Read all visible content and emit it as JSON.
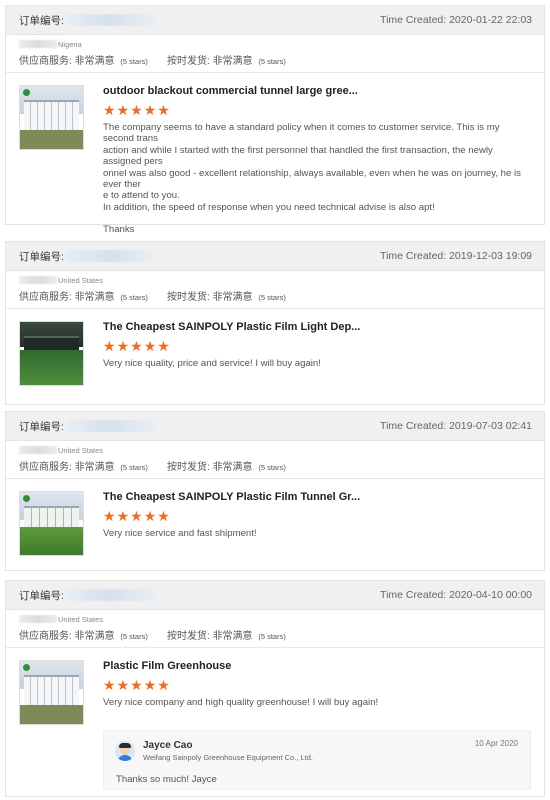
{
  "reviews": [
    {
      "order_label": "订单编号:",
      "time": "Time Created: 2020-01-22 22:03",
      "country": "Nigeria",
      "supplier_label": "供应商服务:",
      "supplier_value": "非常满意",
      "supplier_stars": "(5 stars)",
      "ship_label": "按时发货:",
      "ship_value": "非常满意",
      "ship_stars": "(5 stars)",
      "thumb_icon": "greenhouse-product-thumbnail",
      "title": "outdoor blackout commercial tunnel large gree...",
      "rating": 5,
      "text_lines": [
        "The company seems to have a standard policy when it comes to customer service. This is my second trans",
        "action and while I started with the first personnel that handled the first transaction, the newly assigned pers",
        "onnel was also good - excellent relationship, always available, even when he was on journey, he is ever ther",
        "e to attend to you.",
        "In addition, the speed of response when you need technical advise is also apt!"
      ],
      "closing": "Thanks"
    },
    {
      "order_label": "订单编号:",
      "time": "Time Created: 2019-12-03 19:09",
      "country": "United States",
      "supplier_label": "供应商服务:",
      "supplier_value": "非常满意",
      "supplier_stars": "(5 stars)",
      "ship_label": "按时发货:",
      "ship_value": "非常满意",
      "ship_stars": "(5 stars)",
      "thumb_icon": "light-dep-greenhouse-thumbnail",
      "title": "The Cheapest SAINPOLY Plastic Film Light Dep...",
      "rating": 5,
      "text": "Very nice quality, price and service! I will buy again!"
    },
    {
      "order_label": "订单编号:",
      "time": "Time Created: 2019-07-03 02:41",
      "country": "United States",
      "supplier_label": "供应商服务:",
      "supplier_value": "非常满意",
      "supplier_stars": "(5 stars)",
      "ship_label": "按时发货:",
      "ship_value": "非常满意",
      "ship_stars": "(5 stars)",
      "thumb_icon": "tunnel-greenhouse-thumbnail",
      "title": "The Cheapest SAINPOLY Plastic Film Tunnel Gr...",
      "rating": 5,
      "text": "Very nice service and fast shipment!"
    },
    {
      "order_label": "订单编号:",
      "time": "Time Created: 2020-04-10 00:00",
      "country": "United States",
      "supplier_label": "供应商服务:",
      "supplier_value": "非常满意",
      "supplier_stars": "(5 stars)",
      "ship_label": "按时发货:",
      "ship_value": "非常满意",
      "ship_stars": "(5 stars)",
      "thumb_icon": "plastic-film-greenhouse-thumbnail",
      "title": "Plastic Film Greenhouse",
      "rating": 5,
      "text": "Very nice company and high quality greenhouse! I will buy again!"
    }
  ],
  "reply": {
    "name": "Jayce Cao",
    "company": "Weifang Sainpoly Greenhouse Equipment Co., Ltd.",
    "date": "10 Apr 2020",
    "text": "Thanks so much! Jayce"
  },
  "colors": {
    "star": "#f16a1e",
    "header_bg": "#f0f0f0"
  }
}
